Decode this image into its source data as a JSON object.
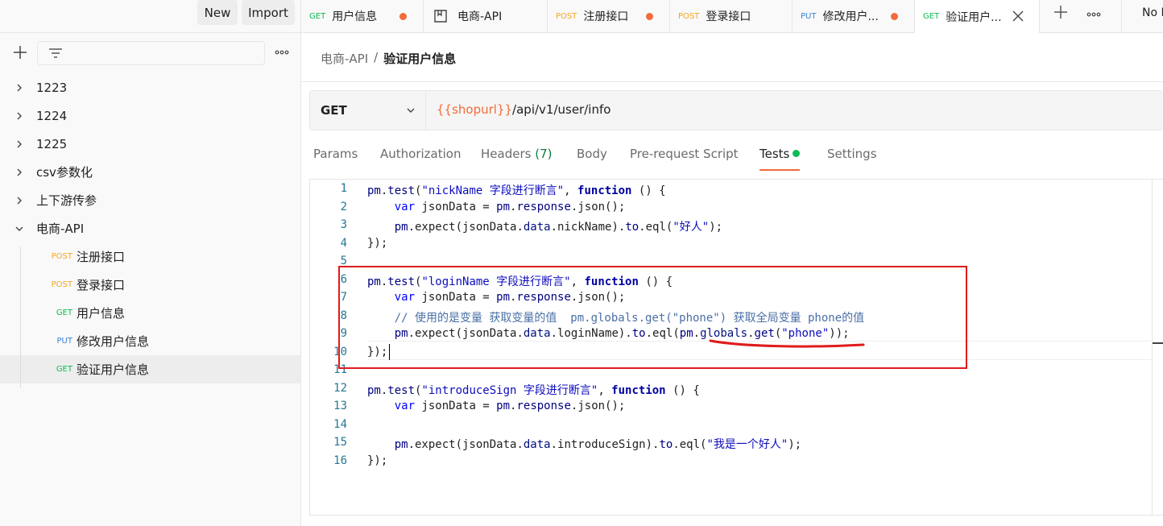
{
  "sidebar": {
    "new_label": "New",
    "import_label": "Import",
    "tree": [
      {
        "type": "folder",
        "label": "1223",
        "expanded": false
      },
      {
        "type": "folder",
        "label": "1224",
        "expanded": false
      },
      {
        "type": "folder",
        "label": "1225",
        "expanded": false
      },
      {
        "type": "folder",
        "label": "csv参数化",
        "expanded": false
      },
      {
        "type": "folder",
        "label": "上下游传参",
        "expanded": false
      },
      {
        "type": "folder",
        "label": "电商-API",
        "expanded": true
      },
      {
        "type": "request",
        "method": "POST",
        "label": "注册接口"
      },
      {
        "type": "request",
        "method": "POST",
        "label": "登录接口"
      },
      {
        "type": "request",
        "method": "GET",
        "label": "用户信息"
      },
      {
        "type": "request",
        "method": "PUT",
        "label": "修改用户信息"
      },
      {
        "type": "request",
        "method": "GET",
        "label": "验证用户信息",
        "active": true
      }
    ]
  },
  "tabs": [
    {
      "method": "GET",
      "name": "用户信息",
      "unsaved": true
    },
    {
      "method": "",
      "name": "电商-API",
      "unsaved": false
    },
    {
      "method": "POST",
      "name": "注册接口",
      "unsaved": true
    },
    {
      "method": "POST",
      "name": "登录接口",
      "unsaved": false
    },
    {
      "method": "PUT",
      "name": "修改用户...",
      "unsaved": true
    },
    {
      "method": "GET",
      "name": "验证用户...",
      "active": true
    }
  ],
  "environment": "No E",
  "breadcrumb": {
    "parent": "电商-API",
    "separator": "/",
    "current": "验证用户信息"
  },
  "request": {
    "method": "GET",
    "url_variable": "{{shopurl}}",
    "url_path": "/api/v1/user/info"
  },
  "request_tabs": {
    "params": "Params",
    "authorization": "Authorization",
    "headers": "Headers",
    "headers_count": "(7)",
    "body": "Body",
    "prerequest": "Pre-request Script",
    "tests": "Tests",
    "settings": "Settings"
  },
  "editor": {
    "line_numbers": [
      "1",
      "2",
      "3",
      "4",
      "5",
      "6",
      "7",
      "8",
      "9",
      "10",
      "11",
      "12",
      "13",
      "14",
      "15",
      "16"
    ]
  },
  "colors": {
    "GET": "#0cbb52",
    "POST": "#f5a623",
    "PUT": "#3b82d4",
    "accent": "#f26b3a",
    "highlight_box": "#e01b1b"
  }
}
